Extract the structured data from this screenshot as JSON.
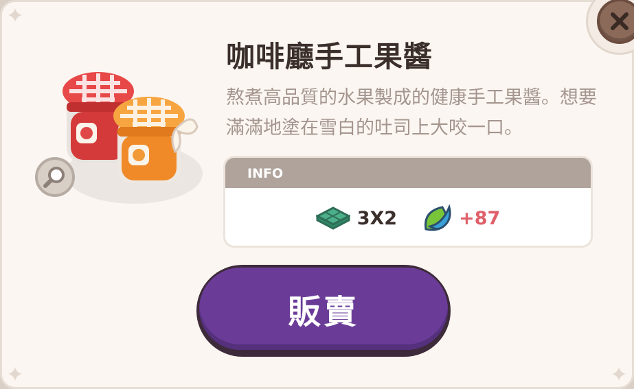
{
  "item": {
    "title": "咖啡廳手工果醬",
    "description": "熬煮高品質的水果製成的健康手工果醬。想要滿滿地塗在雪白的吐司上大咬一口。",
    "image_icon": "jam-jars-icon"
  },
  "info": {
    "header": "INFO",
    "size_icon": "tile-size-icon",
    "size": "3X2",
    "expo_icon": "leaf-drop-icon",
    "expo": "+87"
  },
  "actions": {
    "sell_label": "販賣",
    "close_icon": "close-icon",
    "zoom_icon": "magnify-icon"
  },
  "colors": {
    "panel": "#fbf6f1",
    "title": "#3b2f2c",
    "description": "#a4958e",
    "info_header": "#b0a39c",
    "expo_value": "#e0606a",
    "sell_button": "#6a3c98",
    "close_button": "#8c6a59"
  }
}
